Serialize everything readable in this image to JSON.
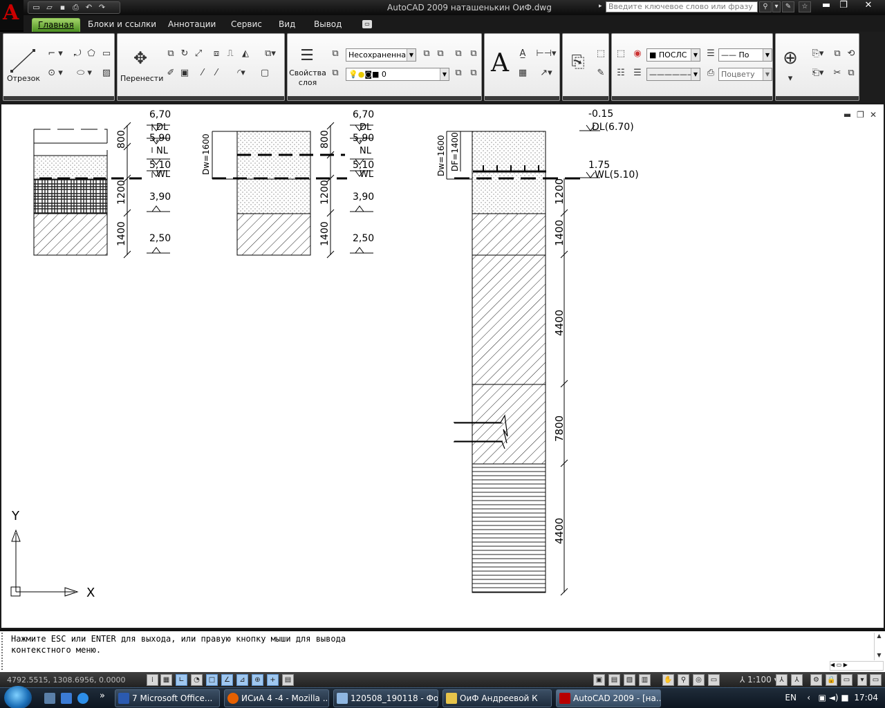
{
  "app": {
    "window_title": "AutoCAD 2009 наташенькин ОиФ.dwg",
    "logo_letter": "A",
    "search_placeholder": "Введите ключевое слово или фразу",
    "accent": "#9acd32"
  },
  "ribbon_tabs": [
    "Главная",
    "Блоки и ссылки",
    "Аннотации",
    "Сервис",
    "Вид",
    "Вывод"
  ],
  "ribbon": {
    "line_label": "Отрезок",
    "move_label": "Перенести",
    "layer_props_label": "Свойства\nслоя",
    "layer_state": "Несохраненна",
    "layer_name": "0",
    "color": "ПОСЛС",
    "linetype": "По",
    "plotstyle": "Поцвету"
  },
  "drawing": {
    "col1": {
      "top": "6,70",
      "dl": "DL",
      "l2": "5,90",
      "nl": "NL",
      "l3": "5,10",
      "wl": "WL",
      "l4": "3,90",
      "l5": "2,50",
      "t1": "800",
      "t2": "1200",
      "t3": "1400"
    },
    "col2": {
      "top": "6,70",
      "dl": "DL",
      "l2": "5,90",
      "nl": "NL",
      "l3": "5,10",
      "wl": "WL",
      "l4": "3,90",
      "l5": "2,50",
      "t1": "800",
      "t2": "1200",
      "t3": "1400",
      "dw": "Dw=1600"
    },
    "col3": {
      "top": "-0.15",
      "dl": "DL(6.70)",
      "l2": "1.75",
      "wl": "WL(5.10)",
      "dw": "Dw=1600",
      "df": "DF=1400",
      "t1": "1200",
      "t2": "1400",
      "t3": "4400",
      "t4": "7800",
      "t5": "4400"
    },
    "ucs_x": "X",
    "ucs_y": "Y"
  },
  "command": {
    "line1": "Нажмите ESC или ENTER для выхода, или правую кнопку мыши для вывода",
    "line2": "контекстного меню."
  },
  "status": {
    "coords": "4792.5515, 1308.6956, 0.0000",
    "scale": "1:100"
  },
  "taskbar": {
    "items": [
      "7 Microsoft Office...",
      "ИСиА 4 -4 - Mozilla ...",
      "120508_190118 - Фо...",
      "ОиФ Андреевой К",
      "AutoCAD 2009 - [на..."
    ],
    "lang": "EN",
    "time": "17:04"
  }
}
